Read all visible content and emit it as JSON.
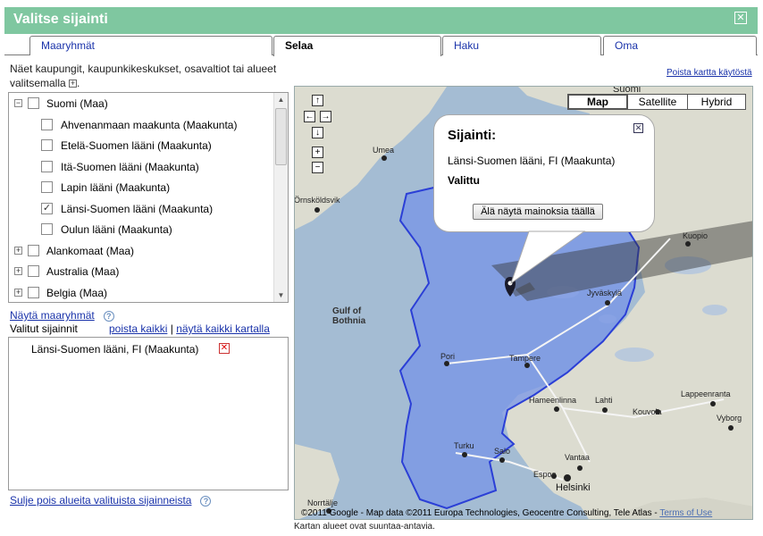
{
  "dialog": {
    "title": "Valitse sijainti",
    "close_glyph": "✕"
  },
  "tabs": [
    {
      "label": "Maaryhmät",
      "active": false
    },
    {
      "label": "Selaa",
      "active": true
    },
    {
      "label": "Haku",
      "active": false
    },
    {
      "label": "Oma",
      "active": false
    }
  ],
  "description": "Näet kaupungit, kaupunkikeskukset, osavaltiot tai alueet valitsemalla",
  "disable_map_link": "Poista kartta käytöstä",
  "tree": {
    "items": [
      {
        "label": "Suomi (Maa)",
        "expander": "−",
        "checked": false
      },
      {
        "label": "Ahvenanmaan maakunta (Maakunta)",
        "checked": false
      },
      {
        "label": "Etelä-Suomen lääni (Maakunta)",
        "checked": false
      },
      {
        "label": "Itä-Suomen lääni (Maakunta)",
        "checked": false
      },
      {
        "label": "Lapin lääni (Maakunta)",
        "checked": false
      },
      {
        "label": "Länsi-Suomen lääni (Maakunta)",
        "checked": true
      },
      {
        "label": "Oulun lääni (Maakunta)",
        "checked": false
      },
      {
        "label": "Alankomaat (Maa)",
        "expander": "+",
        "checked": false
      },
      {
        "label": "Australia (Maa)",
        "expander": "+",
        "checked": false
      },
      {
        "label": "Belgia (Maa)",
        "expander": "+",
        "checked": false
      }
    ],
    "check_glyph": "✓"
  },
  "show_groups_link": "Näytä maaryhmät",
  "selected": {
    "label": "Valitut sijainnit",
    "remove_all": "poista kaikki",
    "separator": "|",
    "show_all_on_map": "näytä kaikki kartalla",
    "items": [
      {
        "label": "Länsi-Suomen lääni, FI (Maakunta)"
      }
    ],
    "remove_glyph": "✕"
  },
  "exclude_link": "Sulje pois alueita valituista sijainneista",
  "map": {
    "types": [
      "Map",
      "Satellite",
      "Hybrid"
    ],
    "active_type": "Map",
    "nav": {
      "up": "↑",
      "left": "←",
      "right": "→",
      "down": "↓",
      "zoom_in": "+",
      "zoom_out": "−"
    },
    "labels": {
      "suomi": "Suomi",
      "umea": "Umea",
      "ornskoldsvik": "Örnsköldsvik",
      "gulf1": "Gulf of",
      "gulf2": "Bothnia",
      "pori": "Pori",
      "tampere": "Tampere",
      "jyvaskyla": "Jyväskylä",
      "kuopio": "Kuopio",
      "hameenlinna": "Hameenlinna",
      "lahti": "Lahti",
      "kouvola": "Kouvola",
      "lappeenranta": "Lappeenranta",
      "vyborg": "Vyborg",
      "turku": "Turku",
      "salo": "Salo",
      "vantaa": "Vantaa",
      "espoo": "Espoo",
      "helsinki": "Helsinki",
      "norrtalje": "Norrtälje"
    },
    "infowindow": {
      "title": "Sijainti:",
      "location": "Länsi-Suomen lääni, FI (Maakunta)",
      "status": "Valittu",
      "button": "Älä näytä mainoksia täällä"
    },
    "copyright": "©2011 Google - Map data ©2011 Europa Technologies, Geocentre Consulting, Tele Atlas -",
    "terms": "Terms of Use",
    "note": "Kartan alueet ovat suuntaa-antavia."
  },
  "colors": {
    "titlebar": "#7fc7a0",
    "link": "#1a33aa",
    "sea": "#a4bcd3",
    "land": "#dcdcd0",
    "region": "#7593e8"
  }
}
